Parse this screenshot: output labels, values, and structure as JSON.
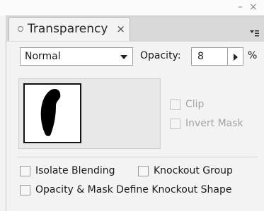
{
  "panel": {
    "tab_label": "Transparency",
    "blend_mode": {
      "value": "Normal"
    },
    "opacity": {
      "label": "Opacity:",
      "value": "8",
      "unit": "%"
    },
    "mask_options": [
      {
        "label": "Clip",
        "checked": false,
        "enabled": false
      },
      {
        "label": "Invert Mask",
        "checked": false,
        "enabled": false
      }
    ],
    "options": {
      "isolate_blending": "Isolate Blending",
      "knockout_group": "Knockout Group",
      "opacity_mask_define_knockout": "Opacity & Mask Define Knockout Shape"
    }
  }
}
